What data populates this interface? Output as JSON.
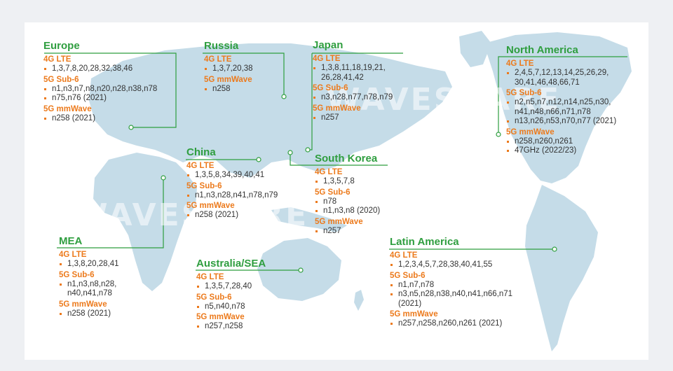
{
  "watermarks": [
    "WAVESHARE",
    "WAVESHARE"
  ],
  "regions": {
    "europe": {
      "title": "Europe",
      "groups": [
        {
          "label": "4G LTE",
          "items": [
            "1,3,7,8,20,28,32,38,46"
          ]
        },
        {
          "label": "5G Sub-6",
          "items": [
            "n1,n3,n7,n8,n20,n28,n38,n78",
            "n75,n76 (2021)"
          ]
        },
        {
          "label": "5G mmWave",
          "items": [
            "n258 (2021)"
          ]
        }
      ]
    },
    "russia": {
      "title": "Russia",
      "groups": [
        {
          "label": "4G LTE",
          "items": [
            "1,3,7,20,38"
          ]
        },
        {
          "label": "5G mmWave",
          "items": [
            "n258"
          ]
        }
      ]
    },
    "japan": {
      "title": "Japan",
      "groups": [
        {
          "label": "4G LTE",
          "items": [
            "1,3,8,11,18,19,21,\n26,28,41,42"
          ]
        },
        {
          "label": "5G Sub-6",
          "items": [
            "n3,n28,n77,n78,n79"
          ]
        },
        {
          "label": "5G mmWave",
          "items": [
            "n257"
          ]
        }
      ]
    },
    "north_america": {
      "title": "North America",
      "groups": [
        {
          "label": "4G LTE",
          "items": [
            "2,4,5,7,12,13,14,25,26,29,\n30,41,46,48,66,71"
          ]
        },
        {
          "label": "5G Sub-6",
          "items": [
            "n2,n5,n7,n12,n14,n25,n30,\nn41,n48,n66,n71,n78",
            "n13,n26,n53,n70,n77 (2021)"
          ]
        },
        {
          "label": "5G mmWave",
          "items": [
            "n258,n260,n261",
            "47GHz (2022/23)"
          ]
        }
      ]
    },
    "china": {
      "title": "China",
      "groups": [
        {
          "label": "4G LTE",
          "items": [
            "1,3,5,8,34,39,40,41"
          ]
        },
        {
          "label": "5G Sub-6",
          "items": [
            "n1,n3,n28,n41,n78,n79"
          ]
        },
        {
          "label": "5G mmWave",
          "items": [
            "n258 (2021)"
          ]
        }
      ]
    },
    "south_korea": {
      "title": "South Korea",
      "groups": [
        {
          "label": "4G LTE",
          "items": [
            "1,3,5,7,8"
          ]
        },
        {
          "label": "5G Sub-6",
          "items": [
            "n78",
            "n1,n3,n8 (2020)"
          ]
        },
        {
          "label": "5G mmWave",
          "items": [
            "n257"
          ]
        }
      ]
    },
    "mea": {
      "title": "MEA",
      "groups": [
        {
          "label": "4G LTE",
          "items": [
            "1,3,8,20,28,41"
          ]
        },
        {
          "label": "5G Sub-6",
          "items": [
            "n1,n3,n8,n28,\nn40,n41,n78"
          ]
        },
        {
          "label": "5G mmWave",
          "items": [
            "n258 (2021)"
          ]
        }
      ]
    },
    "australia_sea": {
      "title": "Australia/SEA",
      "groups": [
        {
          "label": "4G LTE",
          "items": [
            "1,3,5,7,28,40"
          ]
        },
        {
          "label": "5G Sub-6",
          "items": [
            "n5,n40,n78"
          ]
        },
        {
          "label": "5G mmWave",
          "items": [
            "n257,n258"
          ]
        }
      ]
    },
    "latin_america": {
      "title": "Latin America",
      "groups": [
        {
          "label": "4G LTE",
          "items": [
            "1,2,3,4,5,7,28,38,40,41,55"
          ]
        },
        {
          "label": "5G Sub-6",
          "items": [
            "n1,n7,n78",
            "n3,n5,n28,n38,n40,n41,n66,n71\n(2021)"
          ]
        },
        {
          "label": "5G mmWave",
          "items": [
            "n257,n258,n260,n261 (2021)"
          ]
        }
      ]
    }
  }
}
